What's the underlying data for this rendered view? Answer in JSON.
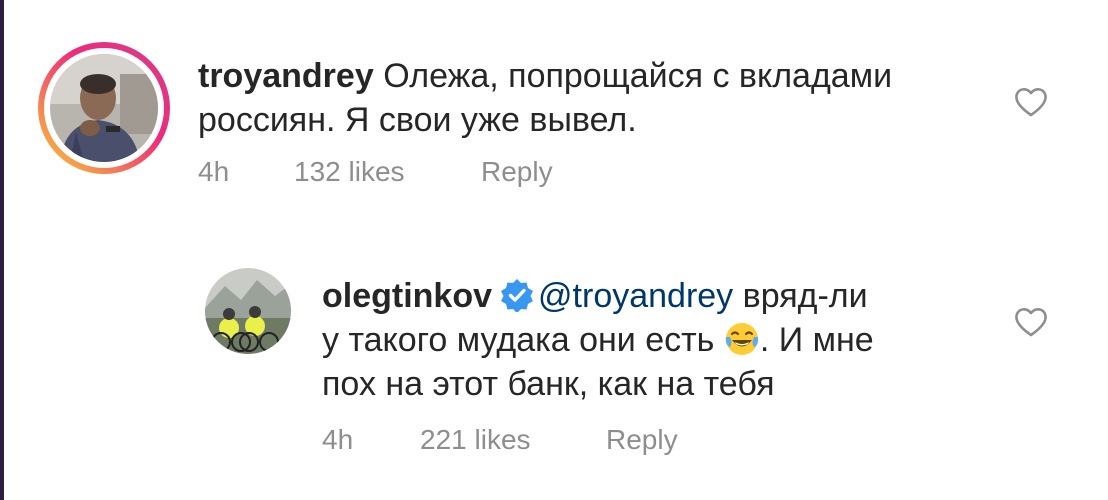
{
  "comments": [
    {
      "username": "troyandrey",
      "text": "Олежа, попрощайся с вкладами россиян. Я свои уже вывел.",
      "time": "4h",
      "likes": "132 likes",
      "reply": "Reply",
      "avatar": "person-photo",
      "icon": "heart-outline-icon"
    },
    {
      "username": "olegtinkov",
      "verified": true,
      "mention": "@troyandrey",
      "text_part1": "вряд-ли",
      "text_line2": "у такого мудака они есть",
      "emoji": "face-with-tears-of-joy",
      "text_after_emoji": ". И мне",
      "text_line3": "пох на этот банк, как на тебя",
      "time": "4h",
      "likes": "221 likes",
      "reply": "Reply",
      "avatar": "cyclists-photo",
      "icon": "heart-outline-icon"
    }
  ],
  "colors": {
    "text": "#262626",
    "muted": "#8e8e8e",
    "mention": "#00376b",
    "verified": "#3897f0"
  }
}
